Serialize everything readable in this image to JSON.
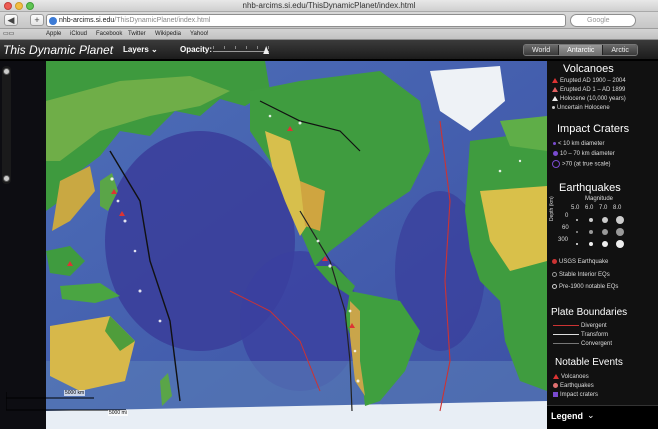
{
  "browser": {
    "window_title": "nhb-arcims.si.edu/ThisDynamicPlanet/index.html",
    "back_label": "◀",
    "forward_label": "▶",
    "add_label": "+",
    "url_host": "nhb-arcims.si.edu",
    "url_path": "/ThisDynamicPlanet/index.html",
    "search_placeholder": "Google",
    "bookmarks": [
      "Apple",
      "iCloud",
      "Facebook",
      "Twitter",
      "Wikipedia",
      "Yahoo!"
    ]
  },
  "app": {
    "title": "This Dynamic Planet",
    "layers_label": "Layers",
    "opacity_label": "Opacity:",
    "opacity_level": 0.95,
    "views": [
      "World",
      "Antarctic",
      "Arctic"
    ],
    "active_view": "World"
  },
  "map": {
    "scale_top": "5000 km",
    "scale_bottom": "5000 mi"
  },
  "legend": {
    "volcanoes": {
      "title": "Volcanoes",
      "items": [
        "Erupted AD 1900 – 2004",
        "Erupted AD 1 – AD 1899",
        "Holocene (10,000 years)",
        "Uncertain Holocene"
      ]
    },
    "craters": {
      "title": "Impact Craters",
      "items": [
        "< 10 km diameter",
        "10 – 70 km diameter",
        ">70 (at true scale)"
      ]
    },
    "earthquakes": {
      "title": "Earthquakes",
      "magnitude_label": "Magnitude",
      "magnitudes": [
        "5.0",
        "6.0",
        "7.0",
        "8.0"
      ],
      "depth_label": "Depth (km)",
      "depths": [
        "0",
        "60",
        "300"
      ],
      "items": [
        "USGS Earthquake",
        "Stable Interior EQs",
        "Pre-1900 notable EQs"
      ]
    },
    "plates": {
      "title": "Plate Boundaries",
      "items": [
        "Divergent",
        "Transform",
        "Convergent"
      ]
    },
    "events": {
      "title": "Notable Events",
      "items": [
        "Volcanoes",
        "Earthquakes",
        "Impact craters"
      ]
    },
    "footer_label": "Legend"
  },
  "colors": {
    "ocean_deep": "#2b3a8a",
    "ocean_shelf": "#5b8fc4",
    "land_low": "#3f9f3f",
    "land_high": "#d9c04a",
    "volcano_red": "#dd3333",
    "crater_purple": "#7a4bd0"
  }
}
